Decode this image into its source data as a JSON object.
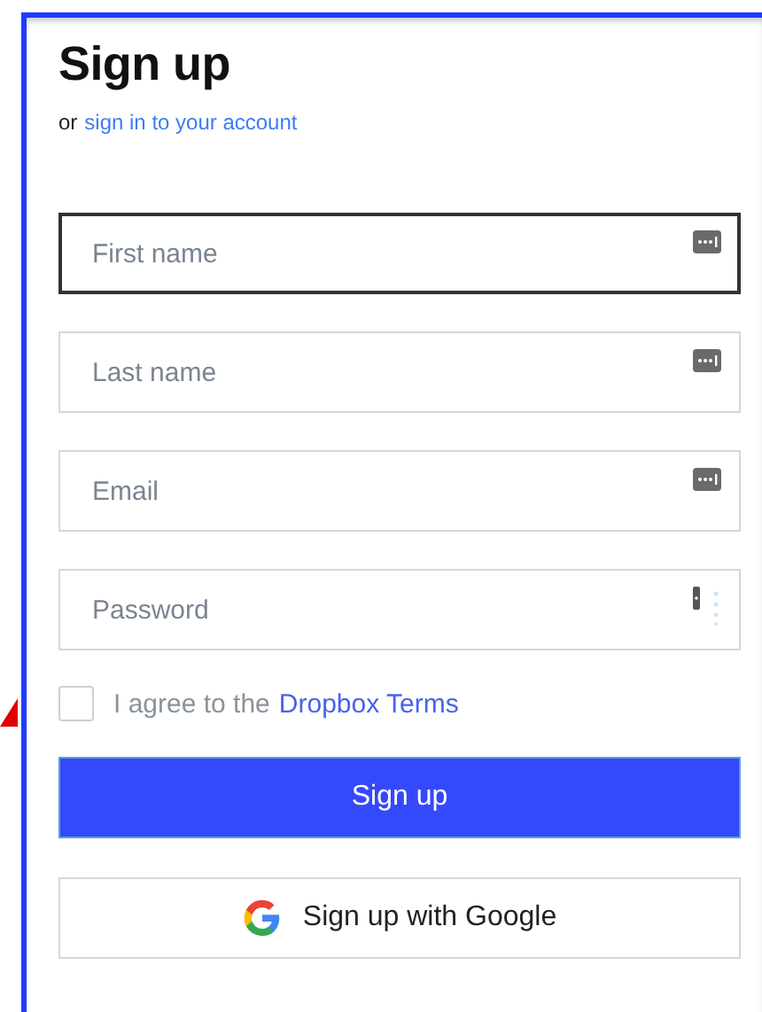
{
  "heading": "Sign up",
  "subtitle": {
    "prefix": "or",
    "link": "sign in to your account"
  },
  "fields": [
    {
      "placeholder": "First name",
      "kind": "plain",
      "focused": true
    },
    {
      "placeholder": "Last name",
      "kind": "plain",
      "focused": false
    },
    {
      "placeholder": "Email",
      "kind": "plain",
      "focused": false
    },
    {
      "placeholder": "Password",
      "kind": "secret",
      "focused": false
    }
  ],
  "terms": {
    "checked": false,
    "prefix": "I agree to the",
    "link": "Dropbox Terms"
  },
  "buttons": [
    {
      "label": "Sign up",
      "kind": "primary"
    },
    {
      "label": "Sign up with Google",
      "kind": "google"
    }
  ]
}
